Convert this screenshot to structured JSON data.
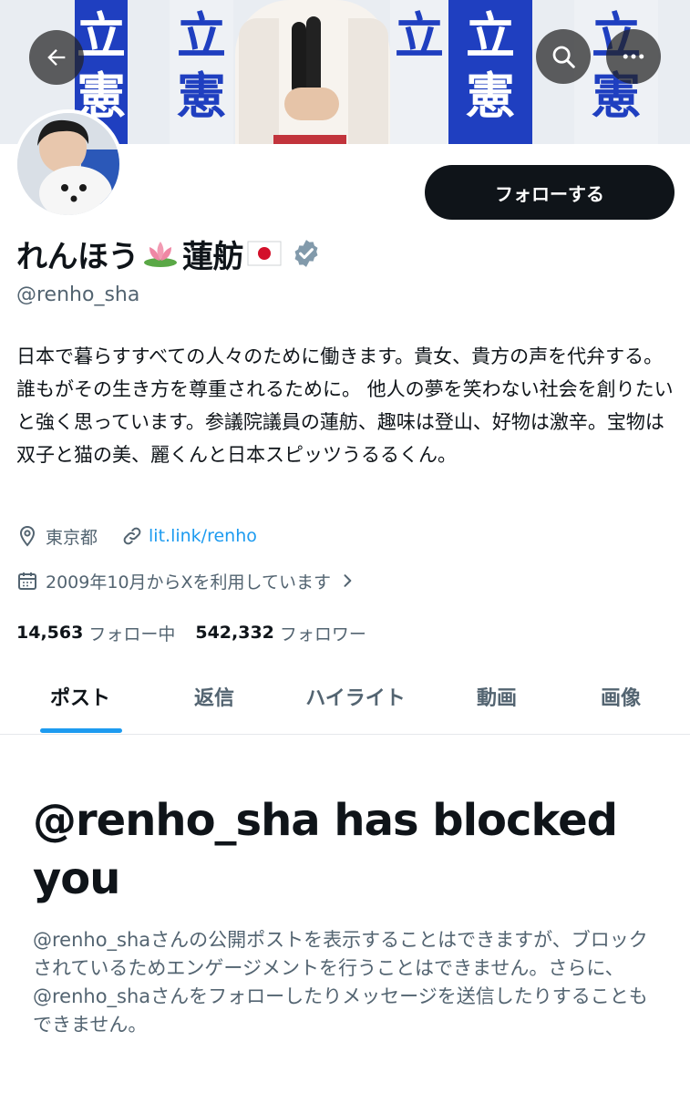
{
  "banner": {
    "poster_text": "立憲民"
  },
  "nav": {
    "back_icon": "arrow-left-icon",
    "search_icon": "search-icon",
    "more_icon": "ellipsis-icon"
  },
  "profile": {
    "name": "れんほう",
    "name_suffix": "蓮舫",
    "handle": "@renho_sha",
    "verified_color": "#829aab",
    "bio": "日本で暮らすすべての人々のために働きます。貴女、貴方の声を代弁する。 誰もがその生き方を尊重されるために。 他人の夢を笑わない社会を創りたいと強く思っています。参議院議員の蓮舫、趣味は登山、好物は激辛。宝物は双子と猫の美、麗くんと日本スピッツうるるくん。",
    "location": "東京都",
    "website": "lit.link/renho",
    "joined": "2009年10月からXを利用しています",
    "following_count": "14,563",
    "following_label": "フォロー中",
    "followers_count": "542,332",
    "followers_label": "フォロワー"
  },
  "follow_button": {
    "label": "フォローする"
  },
  "tabs": [
    {
      "label": "ポスト"
    },
    {
      "label": "返信"
    },
    {
      "label": "ハイライト"
    },
    {
      "label": "動画"
    },
    {
      "label": "画像"
    }
  ],
  "blocked": {
    "title": "@renho_sha has blocked you",
    "message": "@renho_shaさんの公開ポストを表示することはできますが、ブロックされているためエンゲージメントを行うことはできません。さらに、@renho_shaさんをフォローしたりメッセージを送信したりすることもできません。"
  },
  "colors": {
    "accent": "#1d9bf0",
    "text": "#0f1419",
    "secondary": "#536471",
    "banner_blue": "#1f3fc0"
  }
}
